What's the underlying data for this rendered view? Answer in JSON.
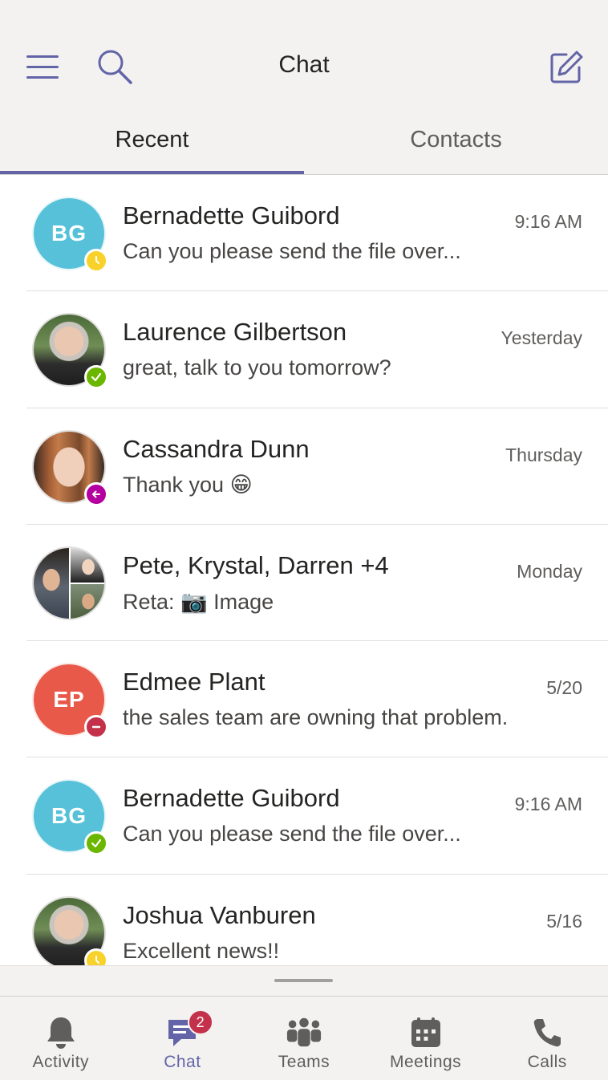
{
  "header": {
    "title": "Chat",
    "menu_icon": "hamburger-menu-icon",
    "search_icon": "search-icon",
    "compose_icon": "compose-icon"
  },
  "tabs": [
    {
      "label": "Recent",
      "active": true
    },
    {
      "label": "Contacts",
      "active": false
    }
  ],
  "colors": {
    "accent": "#6264a7",
    "available": "#6bb700",
    "away": "#f8d22a",
    "dnd": "#c4314b",
    "oof": "#b4009e"
  },
  "chats": [
    {
      "name": "Bernadette Guibord",
      "time": "9:16 AM",
      "preview": "Can you please send the file over...",
      "initials": "BG",
      "avatar_color": "#56c1d8",
      "status": "away"
    },
    {
      "name": "Laurence Gilbertson",
      "time": "Yesterday",
      "preview": "great, talk to you tomorrow?",
      "initials": "",
      "avatar_color": "#8a8886",
      "status": "available"
    },
    {
      "name": "Cassandra Dunn",
      "time": "Thursday",
      "preview": "Thank you 😁",
      "initials": "",
      "avatar_color": "#a56b4f",
      "status": "out-of-office"
    },
    {
      "name": "Pete, Krystal, Darren +4",
      "time": "Monday",
      "preview": "Reta: 📷 Image",
      "initials": "",
      "avatar_color": "#7a7574",
      "status": "none"
    },
    {
      "name": "Edmee Plant",
      "time": "5/20",
      "preview": "the sales team are owning that problem.",
      "initials": "EP",
      "avatar_color": "#e8594a",
      "status": "do-not-disturb"
    },
    {
      "name": "Bernadette Guibord",
      "time": "9:16 AM",
      "preview": "Can you please send the file over...",
      "initials": "BG",
      "avatar_color": "#56c1d8",
      "status": "available"
    },
    {
      "name": "Joshua Vanburen",
      "time": "5/16",
      "preview": "Excellent news!!",
      "initials": "",
      "avatar_color": "#8a8886",
      "status": "away"
    }
  ],
  "tabbar": [
    {
      "label": "Activity",
      "icon": "bell-icon",
      "active": false
    },
    {
      "label": "Chat",
      "icon": "chat-icon",
      "active": true,
      "badge": "2"
    },
    {
      "label": "Teams",
      "icon": "teams-icon",
      "active": false
    },
    {
      "label": "Meetings",
      "icon": "calendar-icon",
      "active": false
    },
    {
      "label": "Calls",
      "icon": "phone-icon",
      "active": false
    }
  ]
}
